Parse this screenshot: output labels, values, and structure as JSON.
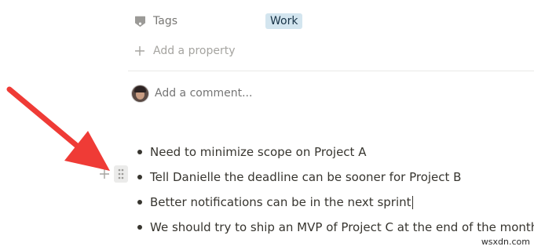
{
  "properties": {
    "tags": {
      "label": "Tags",
      "value": "Work",
      "icon": "tags-icon"
    },
    "add_property_label": "Add a property"
  },
  "comment": {
    "placeholder": "Add a comment..."
  },
  "bullets": [
    "Need to minimize scope on Project A",
    "Tell Danielle the deadline can be sooner for Project B",
    "Better notifications can be in the next sprint",
    "We should try to ship an MVP of Project C at the end of the month"
  ],
  "annotation": {
    "arrow_color": "#ef3b36"
  },
  "colors": {
    "text": "#37352f",
    "muted": "#787774",
    "tag_bg": "#d3e5ef"
  },
  "watermark": "wsxdn.com"
}
